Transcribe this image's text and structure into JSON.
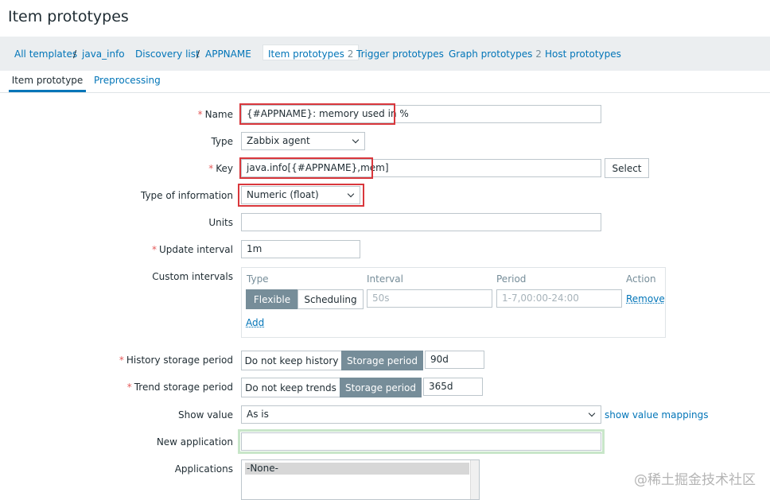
{
  "page": {
    "title": "Item prototypes"
  },
  "breadcrumbs": {
    "all_templates": "All templates",
    "sep1": "/",
    "template": "java_info",
    "discovery_list": "Discovery list",
    "sep2": "/",
    "discovery_rule": "APPNAME",
    "item_prototypes": "Item prototypes",
    "item_prototypes_count": "2",
    "trigger_prototypes": "Trigger prototypes",
    "graph_prototypes": "Graph prototypes",
    "graph_prototypes_count": "2",
    "host_prototypes": "Host prototypes"
  },
  "tabs": {
    "item_prototype": "Item prototype",
    "preprocessing": "Preprocessing"
  },
  "form": {
    "required_mark": "*",
    "name": {
      "label": "Name",
      "value": "{#APPNAME}: memory used  in %"
    },
    "type": {
      "label": "Type",
      "value": "Zabbix agent"
    },
    "key": {
      "label": "Key",
      "value": "java.info[{#APPNAME},mem]",
      "select_button": "Select"
    },
    "type_of_information": {
      "label": "Type of information",
      "value": "Numeric (float)"
    },
    "units": {
      "label": "Units",
      "value": ""
    },
    "update_interval": {
      "label": "Update interval",
      "value": "1m"
    },
    "custom_intervals": {
      "label": "Custom intervals",
      "headers": {
        "type": "Type",
        "interval": "Interval",
        "period": "Period",
        "action": "Action"
      },
      "row": {
        "flexible": "Flexible",
        "scheduling": "Scheduling",
        "interval_placeholder": "50s",
        "period_placeholder": "1-7,00:00-24:00",
        "remove": "Remove"
      },
      "add": "Add"
    },
    "history": {
      "label": "History storage period",
      "do_not_keep": "Do not keep history",
      "storage_period": "Storage period",
      "value": "90d"
    },
    "trend": {
      "label": "Trend storage period",
      "do_not_keep": "Do not keep trends",
      "storage_period": "Storage period",
      "value": "365d"
    },
    "show_value": {
      "label": "Show value",
      "value": "As is",
      "mappings_link": "show value mappings"
    },
    "new_application": {
      "label": "New application",
      "value": ""
    },
    "applications": {
      "label": "Applications",
      "options": [
        "-None-"
      ]
    }
  },
  "watermark": "@稀土掘金技术社区",
  "colors": {
    "link": "#0275b8",
    "required": "#e45959",
    "segment_active": "#768d99",
    "highlight": "#d9373c",
    "focus": "#c8e6c9"
  }
}
